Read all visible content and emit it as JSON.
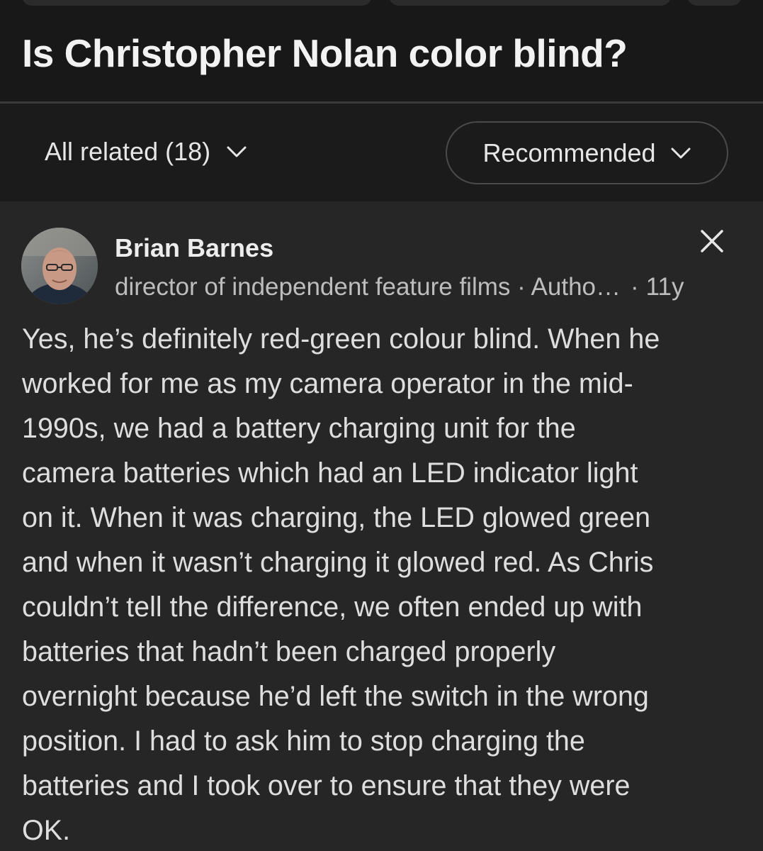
{
  "question": {
    "title": "Is Christopher Nolan color blind?"
  },
  "filter": {
    "all_related_label": "All related (18)",
    "sort_label": "Recommended",
    "chevron_icon": "chevron-down-icon"
  },
  "answer": {
    "author_name": "Brian Barnes",
    "credential": "director of independent feature films · Autho…",
    "separator": "·",
    "age": "11y",
    "close_icon": "close-icon",
    "body_lines": [
      "Yes, he’s definitely red-green colour blind. When he",
      "worked for me as my camera operator in the mid-",
      "1990s, we had a battery charging unit for the",
      "camera batteries which had an LED indicator light",
      "on it. When it was charging, the LED glowed green",
      "and when it wasn’t charging it glowed red. As Chris",
      "couldn’t tell the difference, we often ended up with",
      "batteries that hadn’t been charged properly",
      "overnight because he’d left the switch in the wrong",
      "position. I had to ask him to stop charging the",
      "batteries and I took over to ensure that they were",
      "OK."
    ]
  },
  "colors": {
    "page_bg": "#181818",
    "card_bg": "#262626",
    "text_primary": "#ededed",
    "text_secondary": "#bdbdbd"
  }
}
